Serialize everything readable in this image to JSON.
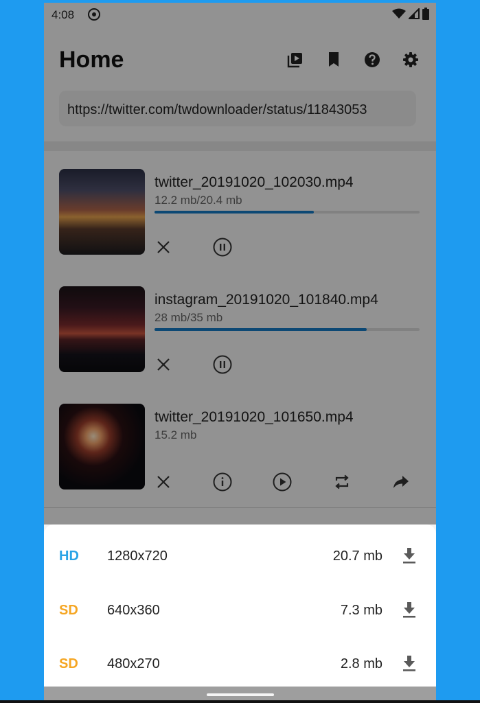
{
  "status_bar": {
    "time": "4:08"
  },
  "app_bar": {
    "title": "Home",
    "toolbar_icons": [
      "video-library-icon",
      "bookmark-icon",
      "help-icon",
      "settings-icon"
    ]
  },
  "url_input": {
    "value": "https://twitter.com/twdownloader/status/11843053"
  },
  "downloads": [
    {
      "filename": "twitter_20191020_102030.mp4",
      "size": "12.2 mb/20.4 mb",
      "progress": 0.6,
      "state": "downloading",
      "actions": [
        "close-icon",
        "pause-icon"
      ]
    },
    {
      "filename": "instagram_20191020_101840.mp4",
      "size": "28 mb/35 mb",
      "progress": 0.8,
      "state": "downloading",
      "actions": [
        "close-icon",
        "pause-icon"
      ]
    },
    {
      "filename": "twitter_20191020_101650.mp4",
      "size": "15.2 mb",
      "state": "completed",
      "actions": [
        "close-icon",
        "info-icon",
        "play-icon",
        "repost-icon",
        "share-icon"
      ]
    }
  ],
  "quality_sheet": {
    "options": [
      {
        "badge": "HD",
        "badge_color": "#29a3e6",
        "resolution": "1280x720",
        "size": "20.7 mb"
      },
      {
        "badge": "SD",
        "badge_color": "#f5a623",
        "resolution": "640x360",
        "size": "7.3 mb"
      },
      {
        "badge": "SD",
        "badge_color": "#f5a623",
        "resolution": "480x270",
        "size": "2.8 mb"
      }
    ]
  },
  "colors": {
    "background": "#1e9bf0",
    "progress": "#1479c2",
    "download_icon": "#5a5a5a"
  }
}
